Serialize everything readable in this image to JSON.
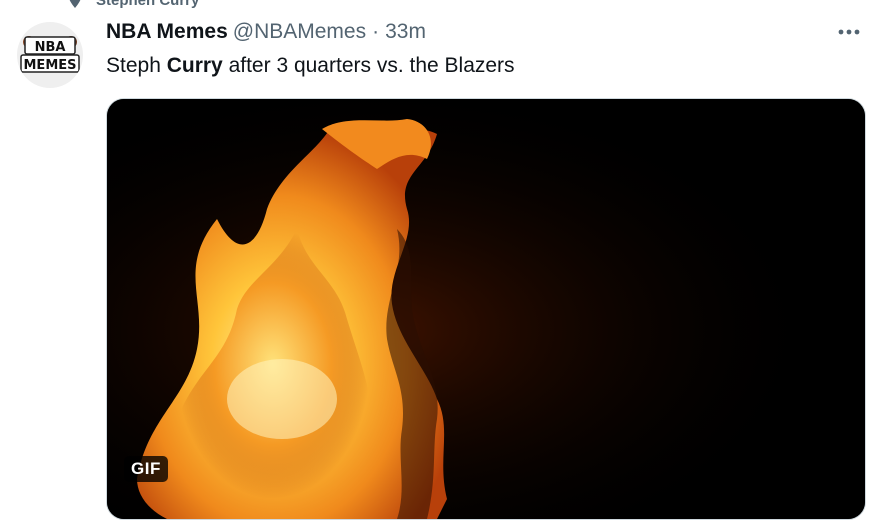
{
  "context": {
    "label": "Stephen Curry",
    "icon": "pin-icon"
  },
  "tweet": {
    "avatar": {
      "line1": "NBA",
      "line2": "MEMES"
    },
    "display_name": "NBA Memes",
    "handle": "@NBAMemes",
    "separator": "·",
    "time": "33m",
    "more_icon": "more-icon",
    "text_before": "Steph ",
    "text_bold": "Curry",
    "text_after": " after 3 quarters vs. the Blazers",
    "media": {
      "type": "gif",
      "badge": "GIF"
    }
  },
  "colors": {
    "text_primary": "#0f1419",
    "text_secondary": "#536471",
    "flame_core": "#ffd34d",
    "flame_outer": "#e8620f"
  }
}
